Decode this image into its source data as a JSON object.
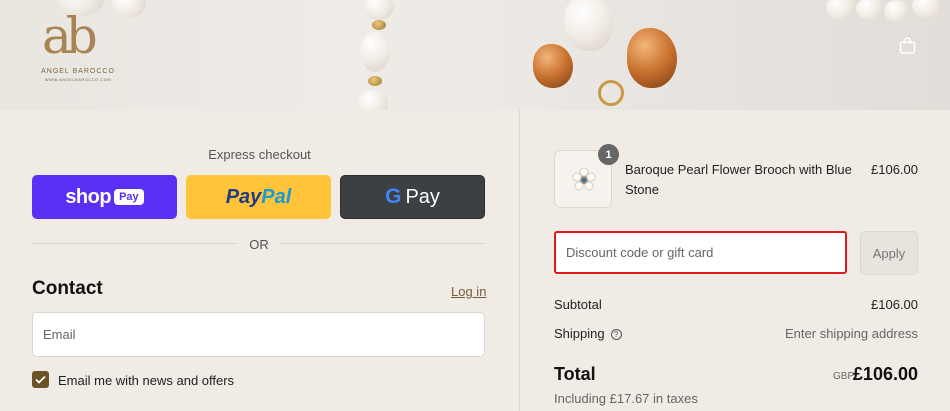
{
  "brand": {
    "logo_mark": "ab",
    "name": "ANGEL BAROCCO",
    "url_line": "WWW.ANGELBAROCCO.COM"
  },
  "express": {
    "label": "Express checkout",
    "shop_word": "shop",
    "shop_pay": "Pay",
    "paypal_1": "Pay",
    "paypal_2": "Pal",
    "gpay_g": "G",
    "gpay_word": "Pay",
    "or": "OR"
  },
  "contact": {
    "title": "Contact",
    "login": "Log in",
    "email_placeholder": "Email",
    "newsletter_label": "Email me with news and offers",
    "newsletter_checked": true
  },
  "order": {
    "item": {
      "quantity": "1",
      "name": "Baroque Pearl Flower Brooch with Blue Stone",
      "price": "£106.00"
    },
    "discount_placeholder": "Discount code or gift card",
    "apply_label": "Apply",
    "subtotal_label": "Subtotal",
    "subtotal_value": "£106.00",
    "shipping_label": "Shipping",
    "shipping_value": "Enter shipping address",
    "total_label": "Total",
    "currency": "GBP",
    "total_value": "£106.00",
    "tax_note": "Including £17.67 in taxes"
  },
  "colors": {
    "background": "#f0ebe4",
    "shop_pay": "#5a31f4",
    "paypal": "#ffc439",
    "gpay": "#3c4043",
    "checkbox": "#6b5227",
    "discount_border": "#e0191e"
  },
  "icons": [
    "bag-icon",
    "help-icon",
    "check-icon",
    "google-g-icon"
  ]
}
